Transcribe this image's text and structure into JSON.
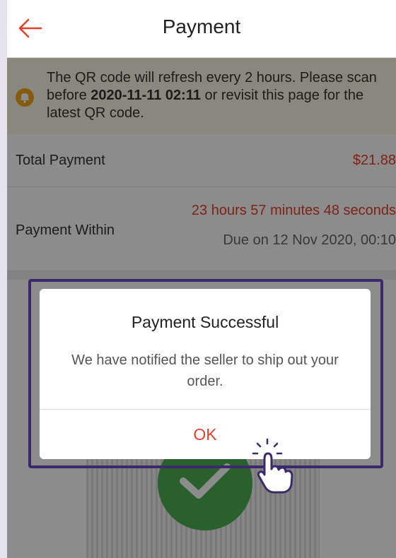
{
  "header": {
    "title": "Payment",
    "back_icon": "arrow-left-icon"
  },
  "notice": {
    "icon": "bell-icon",
    "text_before": "The QR code will refresh every 2 hours. Please scan before ",
    "deadline": "2020-11-11 02:11",
    "text_after": " or revisit this page for the latest QR code."
  },
  "summary": {
    "total_label": "Total Payment",
    "total_value": "$21.88",
    "within_label": "Payment Within",
    "countdown": "23 hours 57 minutes 48 seconds",
    "due": "Due on 12 Nov 2020, 00:10"
  },
  "dialog": {
    "title": "Payment Successful",
    "message": "We have notified the seller to ship out your order.",
    "ok_label": "OK"
  },
  "colors": {
    "accent": "#e5402a",
    "highlight": "#3b2a6b",
    "success": "#4caf50"
  }
}
